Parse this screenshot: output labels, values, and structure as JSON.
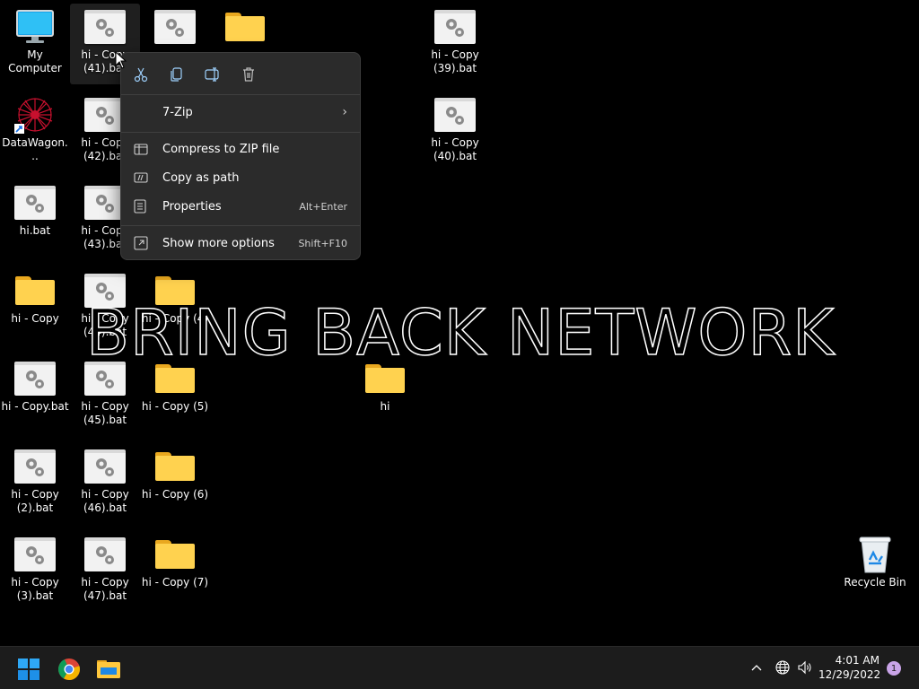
{
  "desktop": {
    "icons": {
      "my_computer": "My Computer",
      "datawagon": "DataWagon...",
      "hi_bat": "hi.bat",
      "hi_copy_folder": "hi - Copy",
      "hi_copy_bat": "hi - Copy.bat",
      "hi_copy_2": "hi - Copy (2).bat",
      "hi_copy_3": "hi - Copy (3).bat",
      "hi_copy_41": "hi - Copy (41).bat",
      "hi_copy_42": "hi - Copy (42).bat",
      "hi_copy_43": "hi - Copy (43).bat",
      "hi_copy_44": "hi - Copy (44).bat",
      "hi_copy_45": "hi - Copy (45).bat",
      "hi_copy_46": "hi - Copy (46).bat",
      "hi_copy_47": "hi - Copy (47).bat",
      "hi_copy_4_folder": "hi - Copy (4)",
      "hi_copy_5_folder": "hi - Copy (5)",
      "hi_copy_6_folder": "hi - Copy (6)",
      "hi_copy_7_folder": "hi - Copy (7)",
      "hi_copy_39": "hi - Copy (39).bat",
      "hi_copy_40": "hi - Copy (40).bat",
      "hi_folder": "hi",
      "recycle_bin": "Recycle Bin"
    },
    "wallpaper_text": "BRING BACK NETWORK"
  },
  "context_menu": {
    "toolbar": [
      "cut-icon",
      "copy-icon",
      "rename-icon",
      "delete-icon"
    ],
    "items": {
      "seven_zip": "7-Zip",
      "compress": "Compress to ZIP file",
      "copy_path": "Copy as path",
      "properties": "Properties",
      "properties_shortcut": "Alt+Enter",
      "more_options": "Show more options",
      "more_options_shortcut": "Shift+F10"
    }
  },
  "taskbar": {
    "apps": [
      "start-icon",
      "chrome-icon",
      "file-explorer-icon"
    ],
    "time": "4:01 AM",
    "date": "12/29/2022",
    "notification_count": "1"
  },
  "colors": {
    "folder": "#ffd24f",
    "menu_bg": "#2b2b2b",
    "taskbar_bg": "#1c1c1c",
    "accent": "#0078d4"
  }
}
